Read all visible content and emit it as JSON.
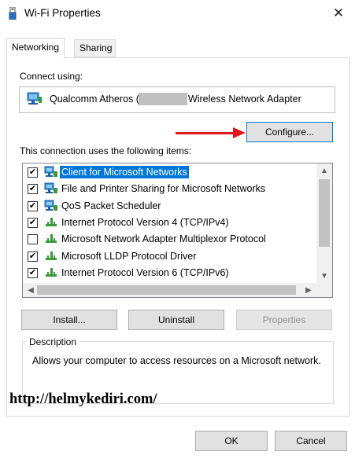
{
  "window": {
    "title": "Wi-Fi Properties",
    "close_glyph": "✕"
  },
  "tabs": [
    {
      "label": "Networking",
      "selected": true
    },
    {
      "label": "Sharing",
      "selected": false
    }
  ],
  "connect_using": {
    "label": "Connect using:",
    "adapter_prefix": "Qualcomm Atheros (",
    "adapter_suffix": "Wireless Network Adapter",
    "configure_label": "Configure..."
  },
  "items": {
    "label": "This connection uses the following items:",
    "list": [
      {
        "label": "Client for Microsoft Networks",
        "checked": true,
        "icon": "network-client-icon",
        "selected": true
      },
      {
        "label": "File and Printer Sharing for Microsoft Networks",
        "checked": true,
        "icon": "network-client-icon",
        "selected": false
      },
      {
        "label": "QoS Packet Scheduler",
        "checked": true,
        "icon": "network-client-icon",
        "selected": false
      },
      {
        "label": "Internet Protocol Version 4 (TCP/IPv4)",
        "checked": true,
        "icon": "protocol-icon",
        "selected": false
      },
      {
        "label": "Microsoft Network Adapter Multiplexor Protocol",
        "checked": false,
        "icon": "protocol-icon",
        "selected": false
      },
      {
        "label": "Microsoft LLDP Protocol Driver",
        "checked": true,
        "icon": "protocol-icon",
        "selected": false
      },
      {
        "label": "Internet Protocol Version 6 (TCP/IPv6)",
        "checked": true,
        "icon": "protocol-icon",
        "selected": false
      }
    ],
    "check_glyph": "✔"
  },
  "buttons": {
    "install": "Install...",
    "uninstall": "Uninstall",
    "properties": "Properties",
    "ok": "OK",
    "cancel": "Cancel"
  },
  "description": {
    "title": "Description",
    "text": "Allows your computer to access resources on a Microsoft network."
  },
  "watermark": "http://helmykediri.com/",
  "colors": {
    "selection": "#0078d7",
    "annotation_arrow": "#e0191d",
    "protocol_green": "#3a9a3a"
  }
}
